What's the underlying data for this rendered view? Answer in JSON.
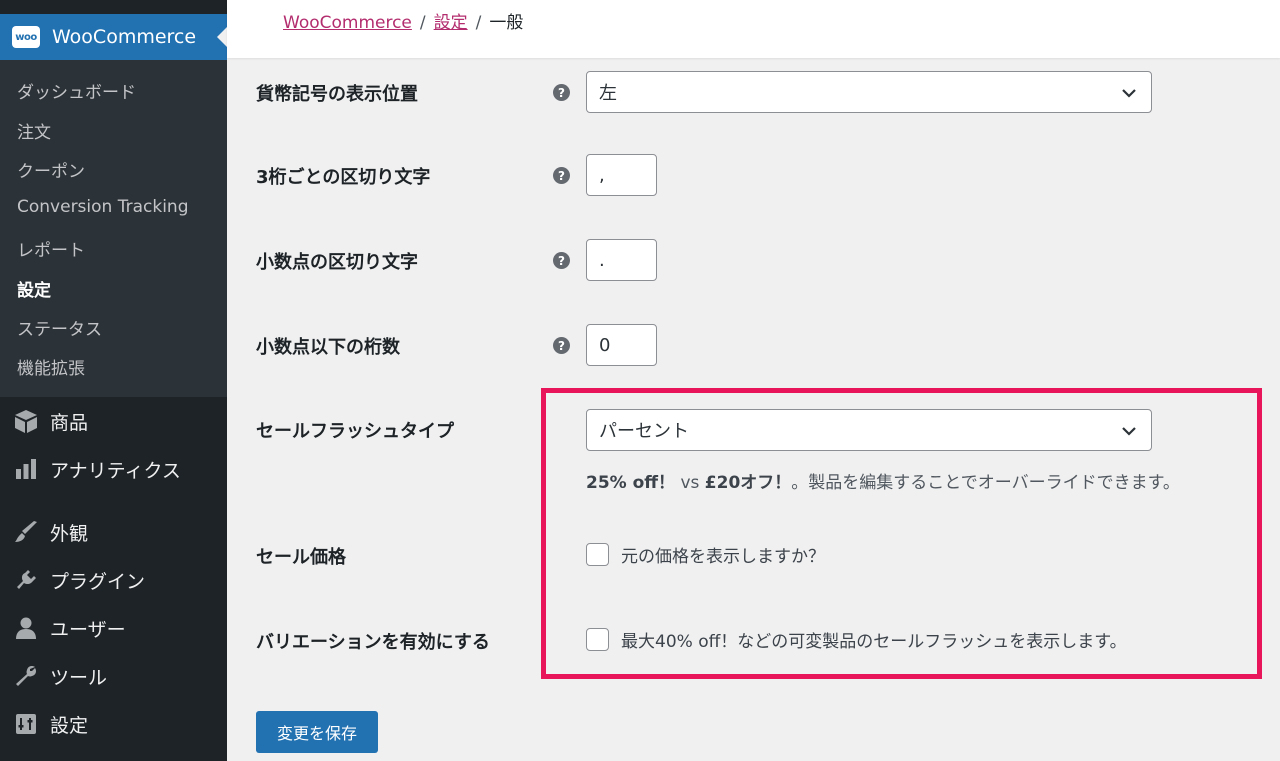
{
  "sidebar": {
    "woocommerce": {
      "logo": "woo",
      "title": "WooCommerce"
    },
    "submenu": [
      {
        "label": "ダッシュボード",
        "active": false
      },
      {
        "label": "注文",
        "active": false
      },
      {
        "label": "クーポン",
        "active": false
      },
      {
        "label": "Conversion Tracking",
        "active": false
      },
      {
        "label": "レポート",
        "active": false
      },
      {
        "label": "設定",
        "active": true
      },
      {
        "label": "ステータス",
        "active": false
      },
      {
        "label": "機能拡張",
        "active": false
      }
    ],
    "menu": [
      {
        "label": "商品",
        "icon": "box-icon"
      },
      {
        "label": "アナリティクス",
        "icon": "bar-chart-icon"
      },
      {
        "label": "外観",
        "icon": "paintbrush-icon"
      },
      {
        "label": "プラグイン",
        "icon": "plug-icon"
      },
      {
        "label": "ユーザー",
        "icon": "user-icon"
      },
      {
        "label": "ツール",
        "icon": "wrench-icon"
      },
      {
        "label": "設定",
        "icon": "settings-icon"
      }
    ]
  },
  "breadcrumb": {
    "item1": "WooCommerce",
    "item2": "設定",
    "item3": "一般",
    "separator": "/"
  },
  "form": {
    "currency_position": {
      "label": "貨幣記号の表示位置",
      "value": "左"
    },
    "thousand_separator": {
      "label": "3桁ごとの区切り文字",
      "value": ","
    },
    "decimal_separator": {
      "label": "小数点の区切り文字",
      "value": "."
    },
    "decimals": {
      "label": "小数点以下の桁数",
      "value": "0"
    },
    "sale_flash_type": {
      "label": "セールフラッシュタイプ",
      "value": "パーセント",
      "desc_bold1": "25% off！",
      "desc_vs": " vs ",
      "desc_bold2": "£20オフ！",
      "desc_rest": "。製品を編集することでオーバーライドできます。"
    },
    "sale_price": {
      "label": "セール価格",
      "checkbox_label": "元の価格を表示しますか？"
    },
    "enable_variations": {
      "label": "バリエーションを有効にする",
      "checkbox_label": "最大40% off！などの可変製品のセールフラッシュを表示します。"
    },
    "help_glyph": "?"
  },
  "save_button": "変更を保存",
  "colors": {
    "accent": "#2271b1",
    "sidebar": "#1d2327",
    "highlight": "#e8155b",
    "link": "#b32d6e"
  }
}
